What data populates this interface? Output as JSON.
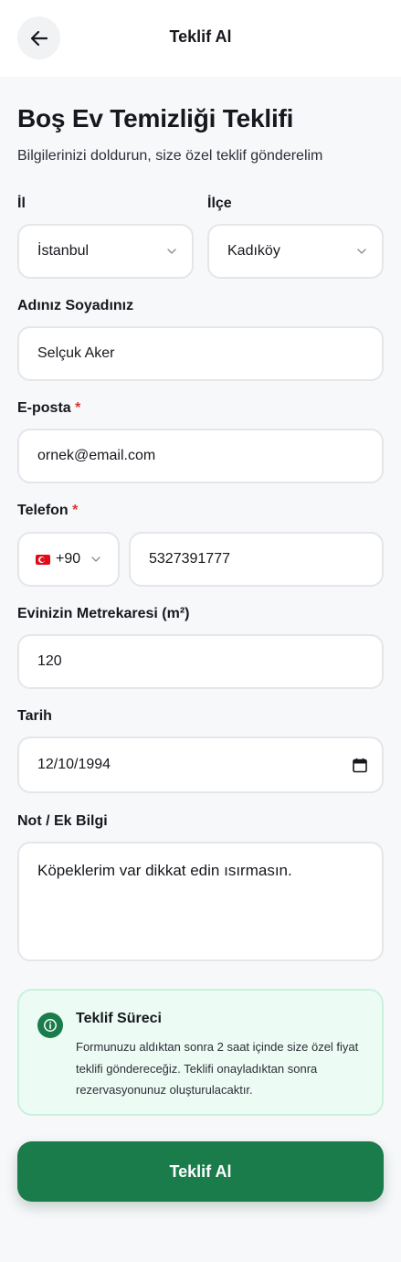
{
  "header": {
    "title": "Teklif Al"
  },
  "page": {
    "title": "Boş Ev Temizliği Teklifi",
    "subtitle": "Bilgilerinizi doldurun, size özel teklif gönderelim"
  },
  "form": {
    "il": {
      "label": "İl",
      "value": "İstanbul"
    },
    "ilce": {
      "label": "İlçe",
      "value": "Kadıköy"
    },
    "name": {
      "label": "Adınız Soyadınız",
      "value": "Selçuk Aker"
    },
    "email": {
      "label": "E-posta",
      "required_mark": "*",
      "value": "ornek@email.com"
    },
    "phone": {
      "label": "Telefon",
      "required_mark": "*",
      "country_code": "+90",
      "value": "5327391777"
    },
    "area": {
      "label": "Evinizin Metrekaresi (m²)",
      "value": "120"
    },
    "date": {
      "label": "Tarih",
      "value": "12/10/1994"
    },
    "note": {
      "label": "Not / Ek Bilgi",
      "value": "Köpeklerim var dikkat edin ısırmasın."
    }
  },
  "info": {
    "title": "Teklif Süreci",
    "text": "Formunuzu aldıktan sonra 2 saat içinde size özel fiyat teklifi göndereceğiz. Teklifi onayladıktan sonra rezervasyonunuz oluşturulacaktır.",
    "icon": "info-icon"
  },
  "submit": {
    "label": "Teklif Al"
  },
  "colors": {
    "primary": "#1a7b4b",
    "info_bg": "#ecfbf3",
    "required": "#d93636",
    "border": "#e4e6ea"
  }
}
